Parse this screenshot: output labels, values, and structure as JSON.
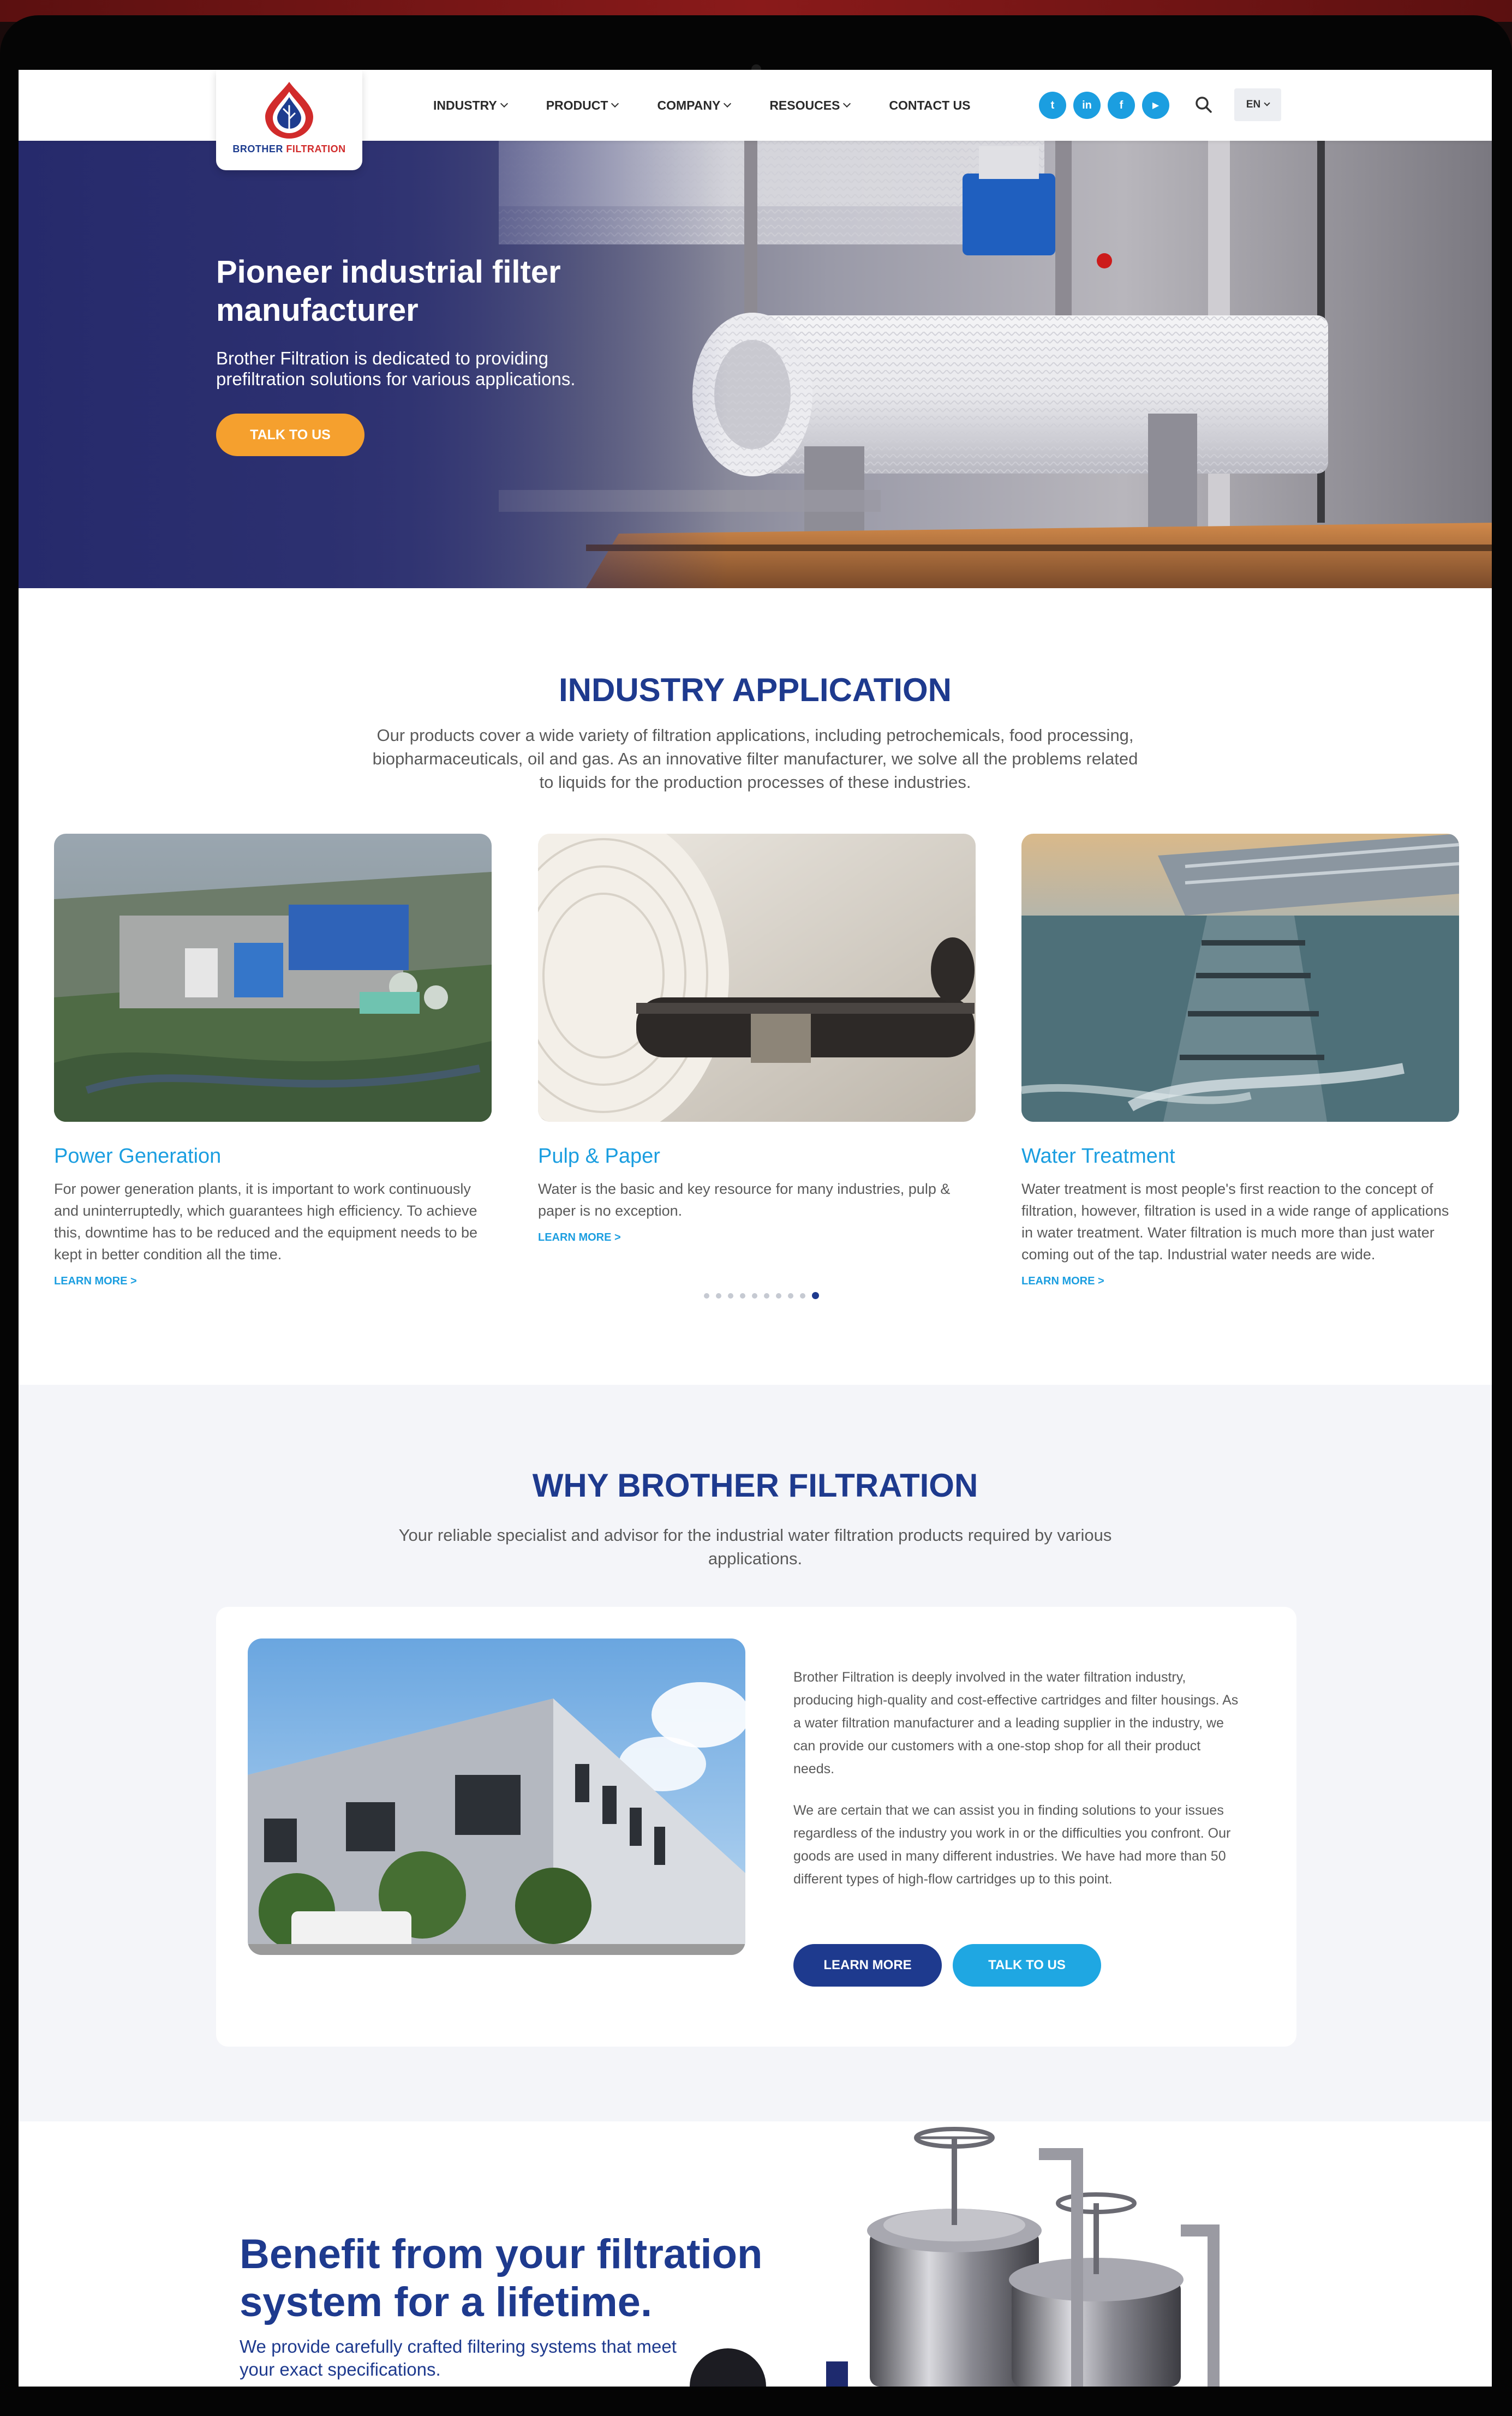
{
  "brand": {
    "name_part1": "BROTHER",
    "name_part2": "FILTRATION"
  },
  "nav": {
    "items": [
      {
        "label": "INDUSTRY"
      },
      {
        "label": "PRODUCT"
      },
      {
        "label": "COMPANY"
      },
      {
        "label": "RESOUCES"
      },
      {
        "label": "CONTACT US"
      }
    ]
  },
  "socials": [
    {
      "icon": "twitter-icon",
      "glyph": "t"
    },
    {
      "icon": "linkedin-icon",
      "glyph": "in"
    },
    {
      "icon": "facebook-icon",
      "glyph": "f"
    },
    {
      "icon": "youtube-icon",
      "glyph": "▶"
    }
  ],
  "language": {
    "label": "EN"
  },
  "hero": {
    "title": "Pioneer industrial filter manufacturer",
    "subtitle": "Brother Filtration is dedicated to providing prefiltration solutions for various applications.",
    "cta": "TALK TO US"
  },
  "industry": {
    "title": "INDUSTRY APPLICATION",
    "description": "Our products cover a wide variety of filtration applications, including petrochemicals, food processing, biopharmaceuticals, oil and gas. As an innovative filter manufacturer, we solve all the problems related to liquids for the production processes of these industries.",
    "cards": [
      {
        "title": "Power Generation",
        "text": "For power generation plants, it is important to work continuously and uninterruptedly, which guarantees high efficiency. To achieve this, downtime has to be reduced and the equipment needs to be kept in better condition all the time.",
        "link": "LEARN MORE >"
      },
      {
        "title": "Pulp & Paper",
        "text": "Water is the basic and key resource for many industries, pulp & paper is no exception.",
        "link": "LEARN MORE >"
      },
      {
        "title": "Water Treatment",
        "text": "Water treatment is most people's first reaction to the concept of filtration, however, filtration is used in a wide range of applications in water treatment. Water filtration is much more than just water coming out of the tap. Industrial water needs are wide.",
        "link": "LEARN MORE >"
      }
    ],
    "pagination": {
      "count": 10,
      "active_index": 9
    }
  },
  "why": {
    "title": "WHY BROTHER FILTRATION",
    "description": "Your reliable specialist and advisor for the industrial water filtration products required by various applications.",
    "paragraph1": "Brother Filtration is deeply involved in the water filtration industry, producing high-quality and cost-effective cartridges and filter housings. As a water filtration manufacturer and a leading supplier in the industry, we can provide our customers with a one-stop shop for all their product needs.",
    "paragraph2": "We are certain that we can assist you in finding solutions to your issues regardless of the industry you work in or the difficulties you confront. Our goods are used in many different industries. We have had more than 50 different types of high-flow cartridges up to this point.",
    "learn_more": "LEARN MORE",
    "talk_to_us": "TALK TO US"
  },
  "benefit": {
    "title": "Benefit from your filtration system for a lifetime.",
    "subtitle": "We provide carefully crafted filtering systems that meet your exact specifications."
  },
  "colors": {
    "navy": "#1e3a8e",
    "accent_blue": "#1b9ee0",
    "orange": "#f5a02e"
  }
}
